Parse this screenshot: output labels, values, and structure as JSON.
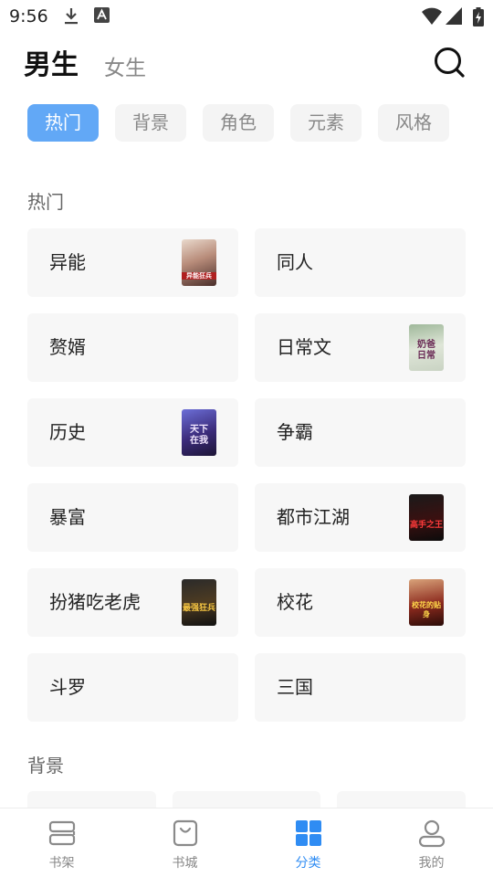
{
  "status_bar": {
    "time": "9:56"
  },
  "header": {
    "tabs": [
      {
        "label": "男生",
        "active": true
      },
      {
        "label": "女生",
        "active": false
      }
    ]
  },
  "filters": [
    "热门",
    "背景",
    "角色",
    "元素",
    "风格"
  ],
  "sections": [
    {
      "title": "热门",
      "categories": [
        {
          "label": "异能",
          "has_cover": true,
          "cover_text": "异能狂兵"
        },
        {
          "label": "同人",
          "has_cover": false
        },
        {
          "label": "赘婿",
          "has_cover": false
        },
        {
          "label": "日常文",
          "has_cover": true,
          "cover_text": "奶爸日常"
        },
        {
          "label": "历史",
          "has_cover": true,
          "cover_text": "天下在我"
        },
        {
          "label": "争霸",
          "has_cover": false
        },
        {
          "label": "暴富",
          "has_cover": false
        },
        {
          "label": "都市江湖",
          "has_cover": true,
          "cover_text": "高手之王"
        },
        {
          "label": "扮猪吃老虎",
          "has_cover": true,
          "cover_text": "最强狂兵"
        },
        {
          "label": "校花",
          "has_cover": true,
          "cover_text": "校花的贴身"
        },
        {
          "label": "斗罗",
          "has_cover": false
        },
        {
          "label": "三国",
          "has_cover": false
        }
      ]
    },
    {
      "title": "背景"
    }
  ],
  "bottom_nav": [
    {
      "label": "书架",
      "icon": "bookshelf-icon",
      "active": false
    },
    {
      "label": "书城",
      "icon": "bookstore-bag-icon",
      "active": false
    },
    {
      "label": "分类",
      "icon": "category-grid-icon",
      "active": true
    },
    {
      "label": "我的",
      "icon": "profile-icon",
      "active": false
    }
  ],
  "colors": {
    "accent": "#2f8cf3",
    "chip_active": "#62a8f6",
    "card_bg": "#f7f7f7",
    "chip_bg": "#f4f4f4"
  }
}
